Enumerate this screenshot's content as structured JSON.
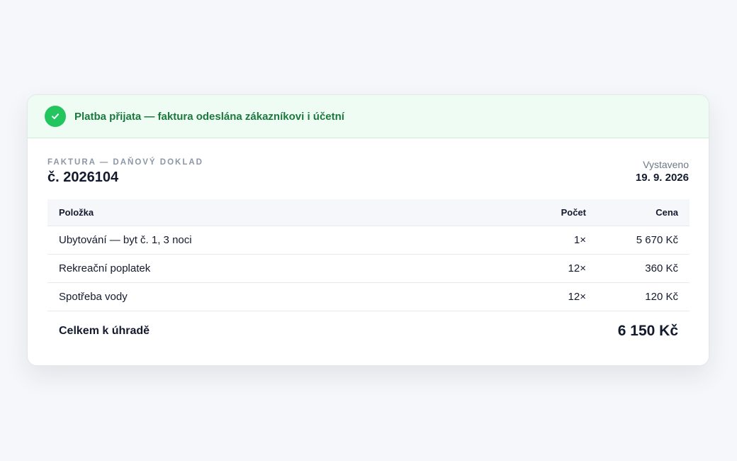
{
  "banner": {
    "icon": "checkmark-circle-icon",
    "message": "Platba přijata — faktura odeslána zákazníkovi i účetní",
    "color": "#22c55e"
  },
  "invoice": {
    "doc_type": "FAKTURA — DAŇOVÝ DOKLAD",
    "number": "č. 2026104",
    "issued_label": "Vystaveno",
    "issued_date": "19. 9. 2026"
  },
  "table": {
    "headers": {
      "item": "Položka",
      "qty": "Počet",
      "price": "Cena"
    },
    "rows": [
      {
        "item": "Ubytování — byt č. 1, 3 noci",
        "qty": "1×",
        "price": "5 670 Kč"
      },
      {
        "item": "Rekreační poplatek",
        "qty": "12×",
        "price": "360 Kč"
      },
      {
        "item": "Spotřeba vody",
        "qty": "12×",
        "price": "120 Kč"
      }
    ],
    "total_label": "Celkem k úhradě",
    "total_value": "6 150 Kč"
  }
}
